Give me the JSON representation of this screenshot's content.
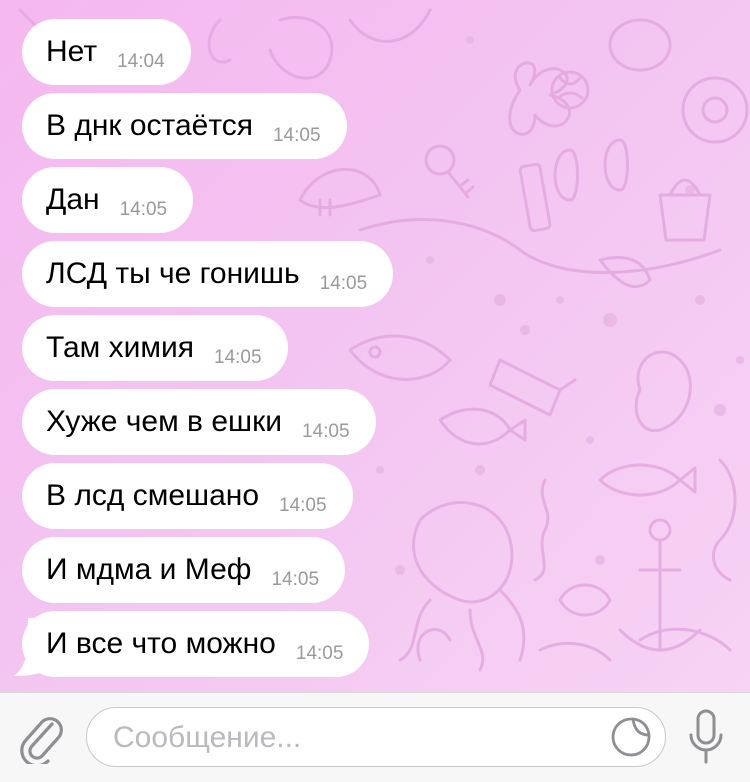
{
  "messages": [
    {
      "text": "Нет",
      "time": "14:04"
    },
    {
      "text": "В днк остаётся",
      "time": "14:05"
    },
    {
      "text": "Дан",
      "time": "14:05"
    },
    {
      "text": "ЛСД ты че гонишь",
      "time": "14:05"
    },
    {
      "text": "Там химия",
      "time": "14:05"
    },
    {
      "text": "Хуже чем в ешки",
      "time": "14:05"
    },
    {
      "text": "В лсд смешано",
      "time": "14:05"
    },
    {
      "text": "И мдма и Меф",
      "time": "14:05"
    },
    {
      "text": "И все что можно",
      "time": "14:05"
    }
  ],
  "composer": {
    "placeholder": "Сообщение...",
    "attach_icon": "paperclip-icon",
    "sticker_icon": "sticker-icon",
    "mic_icon": "microphone-icon"
  },
  "theme": {
    "chat_background": "#f3c4f1",
    "bubble": "#ffffff",
    "time_color": "#9a9a9a",
    "icon_color": "#8e8e93"
  }
}
